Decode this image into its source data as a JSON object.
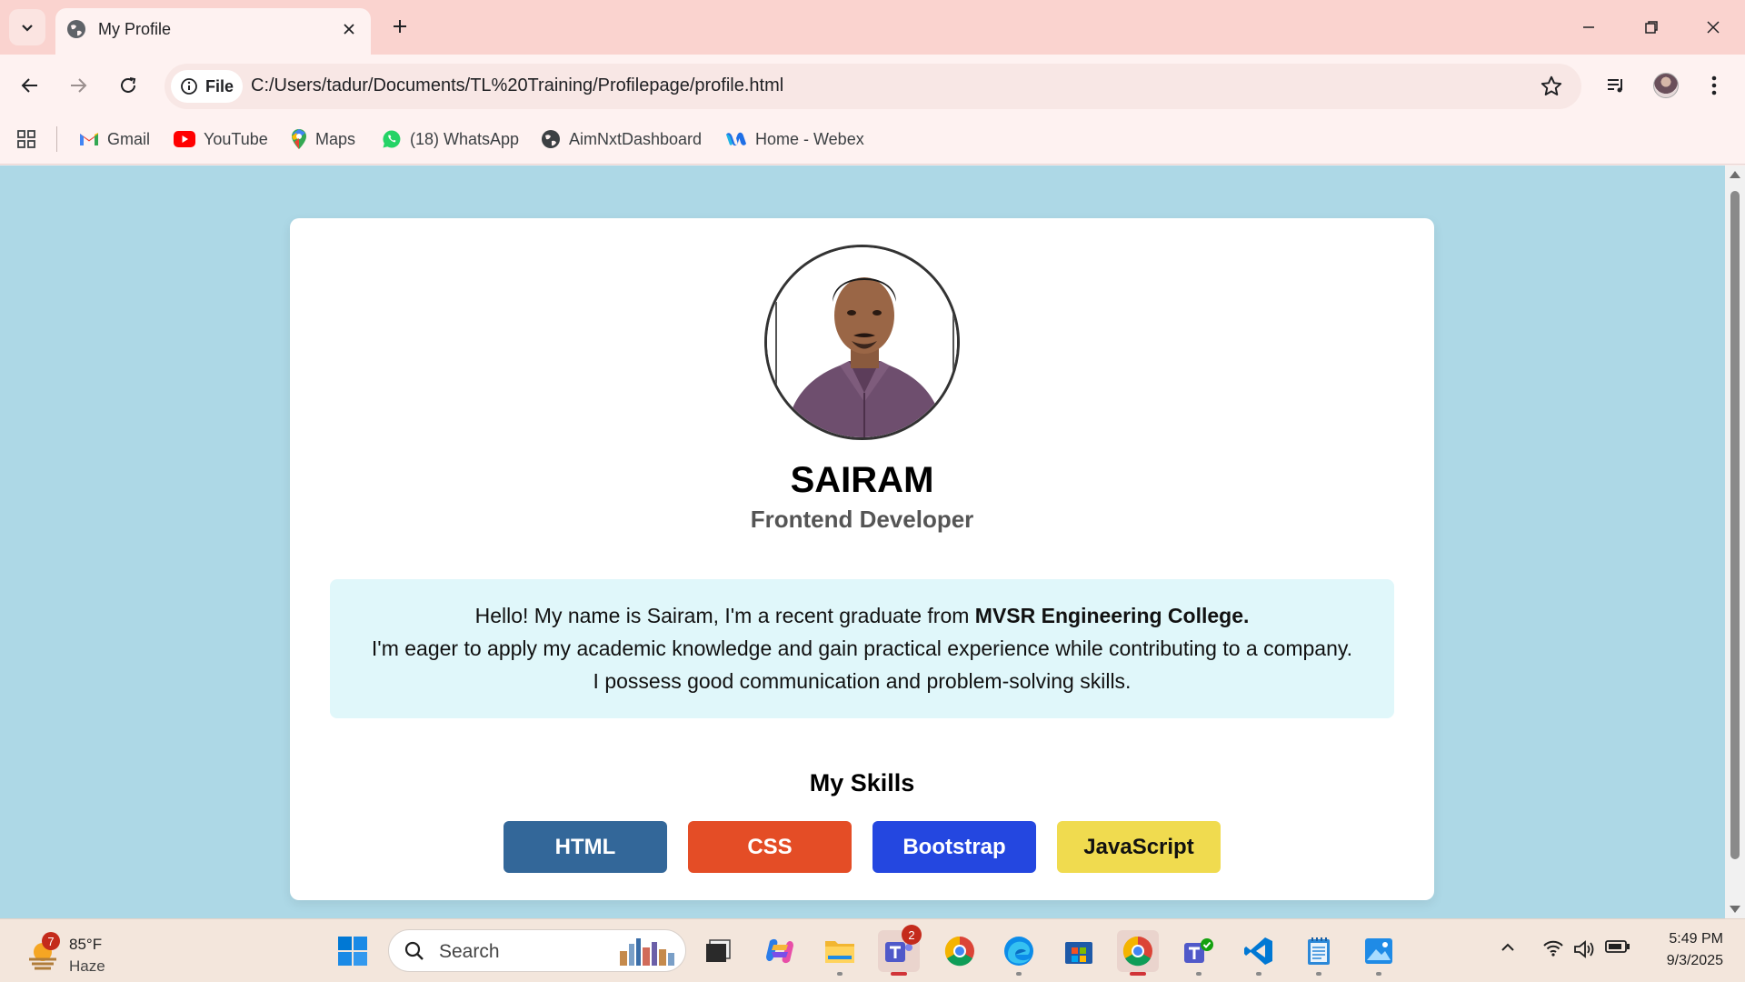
{
  "browser": {
    "tab_title": "My Profile",
    "url": "C:/Users/tadur/Documents/TL%20Training/Profilepage/profile.html",
    "site_chip_label": "File"
  },
  "bookmarks": [
    {
      "label": "Gmail",
      "icon": "gmail-icon"
    },
    {
      "label": "YouTube",
      "icon": "youtube-icon"
    },
    {
      "label": "Maps",
      "icon": "maps-icon"
    },
    {
      "label": "(18) WhatsApp",
      "icon": "whatsapp-icon"
    },
    {
      "label": "AimNxtDashboard",
      "icon": "globe-icon"
    },
    {
      "label": "Home - Webex",
      "icon": "webex-icon"
    }
  ],
  "profile": {
    "name": "SAIRAM",
    "role": "Frontend Developer",
    "about_line1_prefix": "Hello! My name is Sairam, I'm a recent graduate from ",
    "about_line1_bold": "MVSR Engineering College.",
    "about_line2": "I'm eager to apply my academic knowledge and gain practical experience while contributing to a company.",
    "about_line3": "I possess good communication and problem-solving skills.",
    "skills_title": "My Skills",
    "skills": [
      {
        "label": "HTML",
        "color": "#336799",
        "text_color": "#ffffff"
      },
      {
        "label": "CSS",
        "color": "#e44d26",
        "text_color": "#ffffff"
      },
      {
        "label": "Bootstrap",
        "color": "#2447e0",
        "text_color": "#ffffff"
      },
      {
        "label": "JavaScript",
        "color": "#f0db4f",
        "text_color": "#111111"
      }
    ]
  },
  "taskbar": {
    "weather_temp": "85°F",
    "weather_condition": "Haze",
    "weather_badge": "7",
    "search_label": "Search",
    "teams_badge": "2",
    "time": "5:49 PM",
    "date": "9/3/2025"
  },
  "colors": {
    "page_background": "#add8e6",
    "about_background": "#e0f7fa",
    "browser_frame": "#fad3cf"
  }
}
